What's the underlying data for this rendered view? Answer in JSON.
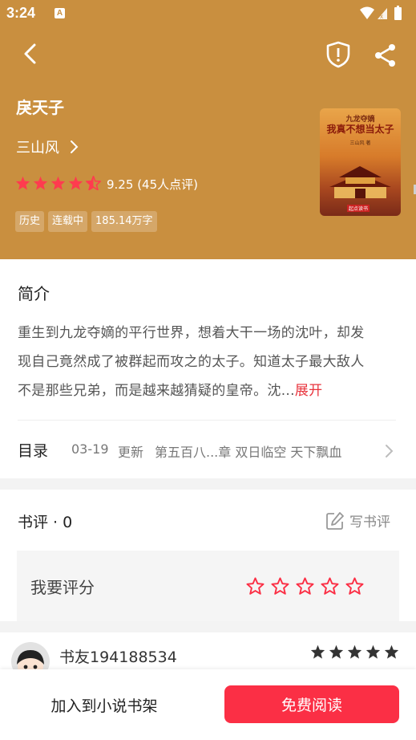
{
  "status_bar": {
    "time": "3:24",
    "notification_letter": "A"
  },
  "book": {
    "title": "戾天子",
    "author": "三山风",
    "rating_stars": 4.5,
    "rating_score": "9.25",
    "rating_count": "(45人点评)",
    "tags": [
      "历史",
      "连载中",
      "185.14万字"
    ],
    "cover": {
      "small_title": "九龙夺嫡",
      "big_title": "我真不想当太子",
      "author_text": "三山风 著",
      "brand": "起点读书"
    }
  },
  "intro": {
    "title": "简介",
    "line1": "重生到九龙夺嫡的平行世界，想着大干一场的沈叶，却发",
    "line2": "现自己竟然成了被群起而攻之的太子。知道太子最大敌人",
    "line3": "不是那些兄弟，而是越来越猜疑的皇帝。沈...",
    "expand": "展开"
  },
  "toc": {
    "label": "目录",
    "date": "03-19",
    "update": "更新",
    "chapter": "第五百八...章 双日临空 天下飘血"
  },
  "reviews": {
    "title": "书评 · 0",
    "write_label": "写书评",
    "rate_label": "我要评分",
    "user": {
      "name": "书友194188534",
      "stars": 5
    }
  },
  "actions": {
    "add_shelf": "加入到小说书架",
    "read_free": "免费阅读"
  },
  "colors": {
    "header": "#c98f3f",
    "accent": "#fb2f45",
    "star_header": "#ff3b4f"
  }
}
